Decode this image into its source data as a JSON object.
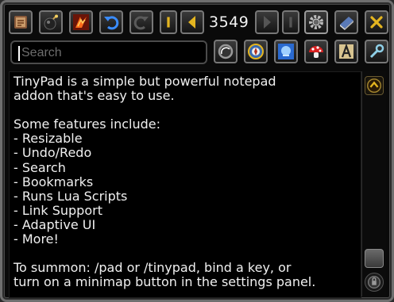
{
  "toolbar": {
    "counter": "3549",
    "buttons": [
      {
        "name": "new-note-button",
        "icon": "scroll-icon"
      },
      {
        "name": "delete-note-button",
        "icon": "bomb-icon"
      },
      {
        "name": "run-script-button",
        "icon": "fire-rune-icon"
      },
      {
        "name": "undo-button",
        "icon": "undo-arrow-icon"
      },
      {
        "name": "redo-button",
        "icon": "redo-arrow-icon"
      },
      {
        "name": "first-page-button",
        "icon": "first-page-icon"
      },
      {
        "name": "previous-page-button",
        "icon": "previous-page-icon"
      },
      {
        "name": "next-page-button",
        "icon": "next-page-icon"
      },
      {
        "name": "last-page-button",
        "icon": "last-page-icon"
      },
      {
        "name": "settings-button",
        "icon": "gear-icon"
      },
      {
        "name": "bookmarks-button",
        "icon": "book-icon"
      },
      {
        "name": "close-button",
        "icon": "close-icon"
      }
    ]
  },
  "search": {
    "placeholder": "Search",
    "tools": [
      {
        "name": "search-option-button",
        "icon": "round-search-icon"
      },
      {
        "name": "font-button",
        "icon": "compass-icon"
      },
      {
        "name": "font-size-button",
        "icon": "frost-face-icon"
      },
      {
        "name": "lock-button",
        "icon": "mushroom-icon"
      },
      {
        "name": "font-face-button",
        "icon": "letter-a-icon"
      },
      {
        "name": "link-button",
        "icon": "link-icon"
      }
    ]
  },
  "editor": {
    "lines": [
      "TinyPad is a simple but powerful notepad",
      "addon that's easy to use.",
      "",
      "Some features include:",
      "- Resizable",
      "- Undo/Redo",
      "- Search",
      "- Bookmarks",
      "- Runs Lua Scripts",
      "- Link Support",
      "- Adaptive UI",
      "- More!",
      "",
      "To summon: /pad or /tinypad, bind a key, or",
      "turn on a minimap button in the settings panel."
    ]
  },
  "scrollbar": {
    "icons": [
      "scroll-up-icon",
      "resize-grip-icon",
      "lock-icon"
    ]
  },
  "colors": {
    "accent_gold": "#e4b520",
    "frame_border": "#6f6f6f",
    "text": "#f0f0f0"
  }
}
